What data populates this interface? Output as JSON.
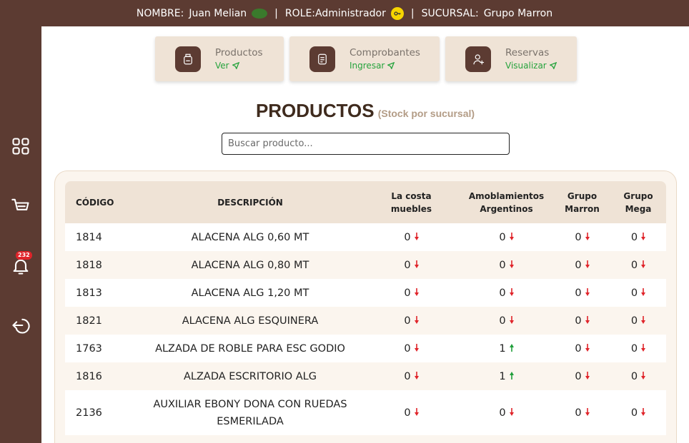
{
  "header": {
    "nombre_label": "NOMBRE:",
    "nombre_value": "Juan Melian",
    "role_label": "ROLE:",
    "role_value": "Administrador",
    "sucursal_label": "SUCURSAL:",
    "sucursal_value": "Grupo Marron"
  },
  "sidebar": {
    "items": [
      {
        "icon": "grid-icon"
      },
      {
        "icon": "cart-icon"
      },
      {
        "icon": "bell-icon",
        "badge": "232"
      },
      {
        "icon": "logout-icon"
      }
    ]
  },
  "cards": [
    {
      "title": "Productos",
      "link": "Ver",
      "icon": "box-icon"
    },
    {
      "title": "Comprobantes",
      "link": "Ingresar",
      "icon": "document-icon"
    },
    {
      "title": "Reservas",
      "link": "Visualizar",
      "icon": "user-plus-icon"
    }
  ],
  "page": {
    "title": "PRODUCTOS",
    "subtitle": "(Stock por sucursal)"
  },
  "search": {
    "placeholder": "Buscar producto..."
  },
  "table": {
    "headers": {
      "code": "CÓDIGO",
      "desc": "DESCRIPCIÓN",
      "s1_l1": "La costa",
      "s1_l2": "muebles",
      "s2_l1": "Amoblamientos",
      "s2_l2": "Argentinos",
      "s3_l1": "Grupo",
      "s3_l2": "Marron",
      "s4_l1": "Grupo",
      "s4_l2": "Mega"
    },
    "rows": [
      {
        "code": "1814",
        "desc": "ALACENA ALG 0,60 MT",
        "s1": "0",
        "s2": "0",
        "s3": "0",
        "s4": "0"
      },
      {
        "code": "1818",
        "desc": "ALACENA ALG 0,80 MT",
        "s1": "0",
        "s2": "0",
        "s3": "0",
        "s4": "0"
      },
      {
        "code": "1813",
        "desc": "ALACENA ALG 1,20 MT",
        "s1": "0",
        "s2": "0",
        "s3": "0",
        "s4": "0"
      },
      {
        "code": "1821",
        "desc": "ALACENA ALG ESQUINERA",
        "s1": "0",
        "s2": "0",
        "s3": "0",
        "s4": "0"
      },
      {
        "code": "1763",
        "desc": "ALZADA DE ROBLE PARA ESC GODIO",
        "s1": "0",
        "s2": "1",
        "s3": "0",
        "s4": "0"
      },
      {
        "code": "1816",
        "desc": "ALZADA ESCRITORIO ALG",
        "s1": "0",
        "s2": "1",
        "s3": "0",
        "s4": "0"
      },
      {
        "code": "2136",
        "desc": "AUXILIAR EBONY DONA CON RUEDAS ESMERILADA",
        "s1": "0",
        "s2": "0",
        "s3": "0",
        "s4": "0"
      }
    ]
  },
  "colors": {
    "brand": "#5c3b32",
    "card_bg": "#efe3d6",
    "link_green": "#26a33d",
    "down_red": "#e0242a",
    "up_green": "#1f9e3a"
  }
}
